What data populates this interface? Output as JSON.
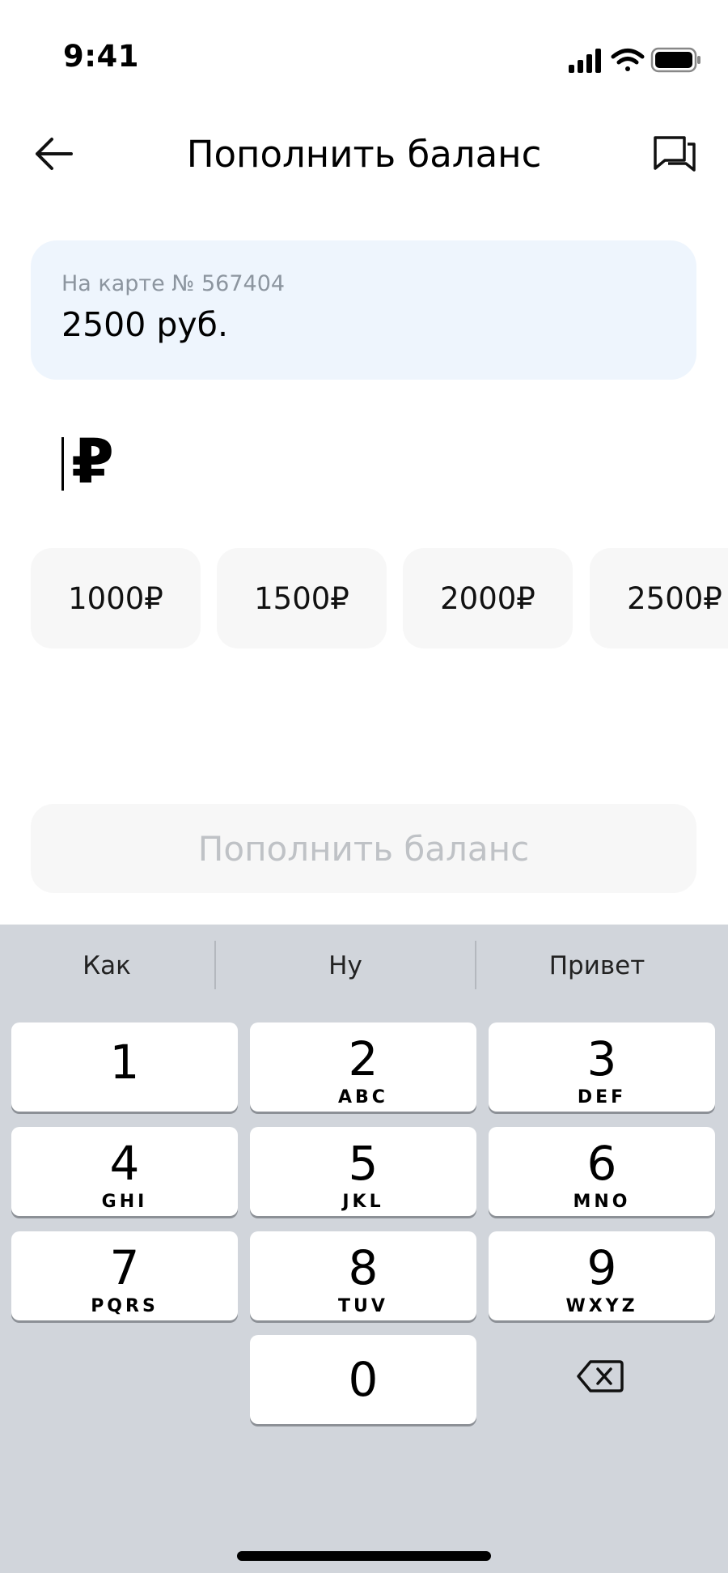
{
  "status_bar": {
    "time": "9:41"
  },
  "header": {
    "title": "Пополнить баланс"
  },
  "card": {
    "label": "На карте № 567404",
    "value": "2500 руб."
  },
  "amount_input": {
    "currency_symbol": "₽"
  },
  "chips": [
    "1000₽",
    "1500₽",
    "2000₽",
    "2500₽"
  ],
  "submit": {
    "label": "Пополнить баланс"
  },
  "keyboard": {
    "suggestions": [
      "Как",
      "Ну",
      "Привет"
    ],
    "keys": [
      {
        "digit": "1",
        "letters": ""
      },
      {
        "digit": "2",
        "letters": "ABC"
      },
      {
        "digit": "3",
        "letters": "DEF"
      },
      {
        "digit": "4",
        "letters": "GHI"
      },
      {
        "digit": "5",
        "letters": "JKL"
      },
      {
        "digit": "6",
        "letters": "MNO"
      },
      {
        "digit": "7",
        "letters": "PQRS"
      },
      {
        "digit": "8",
        "letters": "TUV"
      },
      {
        "digit": "9",
        "letters": "WXYZ"
      },
      {
        "digit": "0",
        "letters": ""
      }
    ]
  },
  "colors": {
    "card_bg": "#eef5fd",
    "chip_bg": "#f7f7f7",
    "button_disabled_text": "#bfc2c6",
    "keyboard_bg": "#d1d5db"
  }
}
